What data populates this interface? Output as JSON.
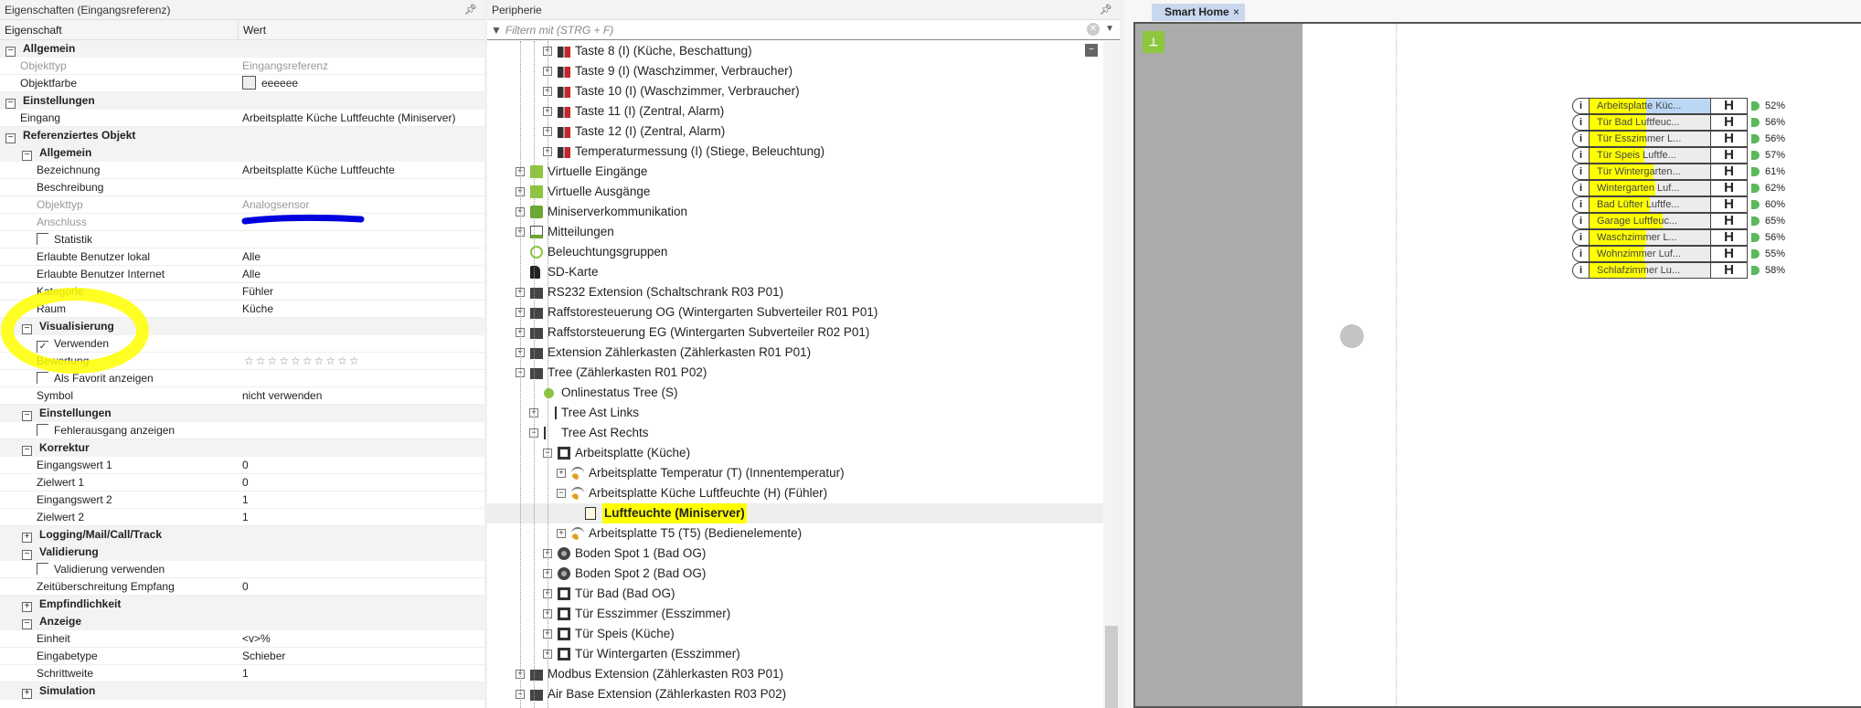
{
  "properties": {
    "title": "Eigenschaften (Eingangsreferenz)",
    "col_key": "Eigenschaft",
    "col_value": "Wert",
    "rows": [
      {
        "type": "group",
        "level": 0,
        "label": "Allgemein",
        "toggle": "−"
      },
      {
        "type": "row",
        "level": 1,
        "label": "Objekttyp",
        "value": "Eingangsreferenz",
        "dim": true
      },
      {
        "type": "color",
        "level": 1,
        "label": "Objektfarbe",
        "value": "eeeeee"
      },
      {
        "type": "group",
        "level": 0,
        "label": "Einstellungen",
        "toggle": "−"
      },
      {
        "type": "row",
        "level": 1,
        "label": "Eingang",
        "value": "Arbeitsplatte Küche Luftfeuchte (Miniserver)"
      },
      {
        "type": "group",
        "level": 0,
        "label": "Referenziertes Objekt",
        "toggle": "−"
      },
      {
        "type": "group",
        "level": 1,
        "label": "Allgemein",
        "toggle": "−"
      },
      {
        "type": "row",
        "level": 2,
        "label": "Bezeichnung",
        "value": "Arbeitsplatte Küche Luftfeuchte"
      },
      {
        "type": "row",
        "level": 2,
        "label": "Beschreibung",
        "value": ""
      },
      {
        "type": "row",
        "level": 2,
        "label": "Objekttyp",
        "value": "Analogsensor",
        "dim": true
      },
      {
        "type": "redacted",
        "level": 2,
        "label": "Anschluss",
        "value": "",
        "dim": true
      },
      {
        "type": "check",
        "level": 2,
        "label": "Statistik",
        "checked": false
      },
      {
        "type": "row",
        "level": 2,
        "label": "Erlaubte Benutzer lokal",
        "value": "Alle"
      },
      {
        "type": "row",
        "level": 2,
        "label": "Erlaubte Benutzer Internet",
        "value": "Alle"
      },
      {
        "type": "row",
        "level": 2,
        "label": "Kategorie",
        "value": "Fühler"
      },
      {
        "type": "row",
        "level": 2,
        "label": "Raum",
        "value": "Küche"
      },
      {
        "type": "group",
        "level": 1,
        "label": "Visualisierung",
        "toggle": "−"
      },
      {
        "type": "check",
        "level": 2,
        "label": "Verwenden",
        "checked": true
      },
      {
        "type": "stars",
        "level": 2,
        "label": "Bewertung",
        "value": "☆☆☆☆☆☆☆☆☆☆"
      },
      {
        "type": "check",
        "level": 2,
        "label": "Als Favorit anzeigen",
        "checked": false
      },
      {
        "type": "row",
        "level": 2,
        "label": "Symbol",
        "value": "     nicht verwenden"
      },
      {
        "type": "group",
        "level": 1,
        "label": "Einstellungen",
        "toggle": "−"
      },
      {
        "type": "check",
        "level": 2,
        "label": "Fehlerausgang anzeigen",
        "checked": false
      },
      {
        "type": "group",
        "level": 1,
        "label": "Korrektur",
        "toggle": "−"
      },
      {
        "type": "row",
        "level": 2,
        "label": "Eingangswert 1",
        "value": "0"
      },
      {
        "type": "row",
        "level": 2,
        "label": "Zielwert 1",
        "value": "0"
      },
      {
        "type": "row",
        "level": 2,
        "label": "Eingangswert 2",
        "value": "1"
      },
      {
        "type": "row",
        "level": 2,
        "label": "Zielwert 2",
        "value": "1"
      },
      {
        "type": "group",
        "level": 1,
        "label": "Logging/Mail/Call/Track",
        "toggle": "+"
      },
      {
        "type": "group",
        "level": 1,
        "label": "Validierung",
        "toggle": "−"
      },
      {
        "type": "check",
        "level": 2,
        "label": "Validierung verwenden",
        "checked": false
      },
      {
        "type": "row",
        "level": 2,
        "label": "Zeitüberschreitung Empfang",
        "value": "0"
      },
      {
        "type": "group",
        "level": 1,
        "label": "Empfindlichkeit",
        "toggle": "+"
      },
      {
        "type": "group",
        "level": 1,
        "label": "Anzeige",
        "toggle": "−"
      },
      {
        "type": "row",
        "level": 2,
        "label": "Einheit",
        "value": "<v>%"
      },
      {
        "type": "row",
        "level": 2,
        "label": "Eingabetype",
        "value": "Schieber"
      },
      {
        "type": "row",
        "level": 2,
        "label": "Schrittweite",
        "value": "1"
      },
      {
        "type": "group",
        "level": 1,
        "label": "Simulation",
        "toggle": "+"
      }
    ]
  },
  "peripherie": {
    "title": "Peripherie",
    "filter_placeholder": "Filtern mit (STRG + F)",
    "items": [
      {
        "level": 3,
        "toggle": "+",
        "icon": "input-icon",
        "label": "Taste 8 (I) (Küche, Beschattung)"
      },
      {
        "level": 3,
        "toggle": "+",
        "icon": "input-icon",
        "label": "Taste 9 (I) (Waschzimmer, Verbraucher)"
      },
      {
        "level": 3,
        "toggle": "+",
        "icon": "input-icon",
        "label": "Taste 10 (I) (Waschzimmer, Verbraucher)"
      },
      {
        "level": 3,
        "toggle": "+",
        "icon": "input-icon",
        "label": "Taste 11 (I) (Zentral, Alarm)"
      },
      {
        "level": 3,
        "toggle": "+",
        "icon": "input-icon",
        "label": "Taste 12 (I) (Zentral, Alarm)"
      },
      {
        "level": 3,
        "toggle": "+",
        "icon": "input-icon",
        "label": "Temperaturmessung (I) (Stiege, Beleuchtung)"
      },
      {
        "level": 1,
        "toggle": "+",
        "icon": "virtual-input-icon",
        "label": "Virtuelle Eingänge"
      },
      {
        "level": 1,
        "toggle": "+",
        "icon": "virtual-output-icon",
        "label": "Virtuelle Ausgänge"
      },
      {
        "level": 1,
        "toggle": "+",
        "icon": "network-icon",
        "label": "Miniserverkommunikation"
      },
      {
        "level": 1,
        "toggle": "+",
        "icon": "log-icon",
        "label": "Mitteilungen"
      },
      {
        "level": 1,
        "toggle": "",
        "icon": "lighting-group-icon",
        "label": "Beleuchtungsgruppen"
      },
      {
        "level": 1,
        "toggle": "",
        "icon": "sd-card-icon",
        "label": "SD-Karte"
      },
      {
        "level": 1,
        "toggle": "+",
        "icon": "extension-icon",
        "label": "RS232 Extension (Schaltschrank R03 P01)"
      },
      {
        "level": 1,
        "toggle": "+",
        "icon": "extension-icon",
        "label": "Raffstoresteuerung OG (Wintergarten Subverteiler R01 P01)"
      },
      {
        "level": 1,
        "toggle": "+",
        "icon": "extension-icon",
        "label": "Raffstorsteuerung EG (Wintergarten Subverteiler R02 P01)"
      },
      {
        "level": 1,
        "toggle": "+",
        "icon": "extension-icon",
        "label": "Extension Zählerkasten (Zählerkasten R01 P01)"
      },
      {
        "level": 1,
        "toggle": "−",
        "icon": "tree-extension-icon",
        "label": "Tree (Zählerkasten R01 P02)"
      },
      {
        "level": 2,
        "toggle": "",
        "icon": "online-status-icon",
        "label": "Onlinestatus Tree (S)"
      },
      {
        "level": 2,
        "toggle": "+",
        "icon": "branch-left-icon",
        "label": "Tree Ast Links"
      },
      {
        "level": 2,
        "toggle": "−",
        "icon": "branch-right-icon",
        "label": "Tree Ast Rechts"
      },
      {
        "level": 3,
        "toggle": "−",
        "icon": "device-icon",
        "label": "Arbeitsplatte (Küche)"
      },
      {
        "level": 4,
        "toggle": "+",
        "icon": "sensor-icon",
        "label": "Arbeitsplatte Temperatur (T) (Innentemperatur)"
      },
      {
        "level": 4,
        "toggle": "−",
        "icon": "sensor-icon",
        "label": "Arbeitsplatte Küche Luftfeuchte (H) (Fühler)"
      },
      {
        "level": 5,
        "toggle": "",
        "icon": "document-icon",
        "label": "Luftfeuchte (Miniserver)",
        "selected": true
      },
      {
        "level": 4,
        "toggle": "+",
        "icon": "sensor-icon",
        "label": "Arbeitsplatte T5 (T5) (Bedienelemente)"
      },
      {
        "level": 3,
        "toggle": "+",
        "icon": "spot-icon",
        "label": "Boden Spot 1 (Bad OG)"
      },
      {
        "level": 3,
        "toggle": "+",
        "icon": "spot-icon",
        "label": "Boden Spot 2 (Bad OG)"
      },
      {
        "level": 3,
        "toggle": "+",
        "icon": "device-icon",
        "label": "Tür Bad (Bad OG)"
      },
      {
        "level": 3,
        "toggle": "+",
        "icon": "device-icon",
        "label": "Tür Esszimmer (Esszimmer)"
      },
      {
        "level": 3,
        "toggle": "+",
        "icon": "device-icon",
        "label": "Tür Speis (Küche)"
      },
      {
        "level": 3,
        "toggle": "+",
        "icon": "device-icon",
        "label": "Tür Wintergarten (Esszimmer)"
      },
      {
        "level": 1,
        "toggle": "+",
        "icon": "extension-icon",
        "label": "Modbus Extension (Zählerkasten R03 P01)"
      },
      {
        "level": 1,
        "toggle": "−",
        "icon": "extension-icon",
        "label": "Air Base Extension (Zählerkasten R03 P02)"
      }
    ]
  },
  "visualization": {
    "tab_label": "Smart Home",
    "tab_close": "×",
    "blocks": [
      {
        "label": "Arbeitsplatte Küc...",
        "type": "H",
        "value": "52%",
        "selected": true
      },
      {
        "label": "Tür Bad Luftfeuc...",
        "type": "H",
        "value": "56%"
      },
      {
        "label": "Tür Esszimmer L...",
        "type": "H",
        "value": "56%"
      },
      {
        "label": "Tür Speis Luftfe...",
        "type": "H",
        "value": "57%"
      },
      {
        "label": "Tür Wintergarten...",
        "type": "H",
        "value": "61%"
      },
      {
        "label": "Wintergarten Luf...",
        "type": "H",
        "value": "62%"
      },
      {
        "label": "Bad Lüfter Luftfe...",
        "type": "H",
        "value": "60%"
      },
      {
        "label": "Garage Luftfeuc...",
        "type": "H",
        "value": "65%"
      },
      {
        "label": "Waschzimmer L...",
        "type": "H",
        "value": "56%"
      },
      {
        "label": "Wohnzimmer Luf...",
        "type": "H",
        "value": "55%"
      },
      {
        "label": "Schlafzimmer Lu...",
        "type": "H",
        "value": "58%"
      }
    ]
  },
  "colors": {
    "highlight": "#ffff00",
    "accent_green": "#8dc63f",
    "redaction": "#0000dd"
  }
}
